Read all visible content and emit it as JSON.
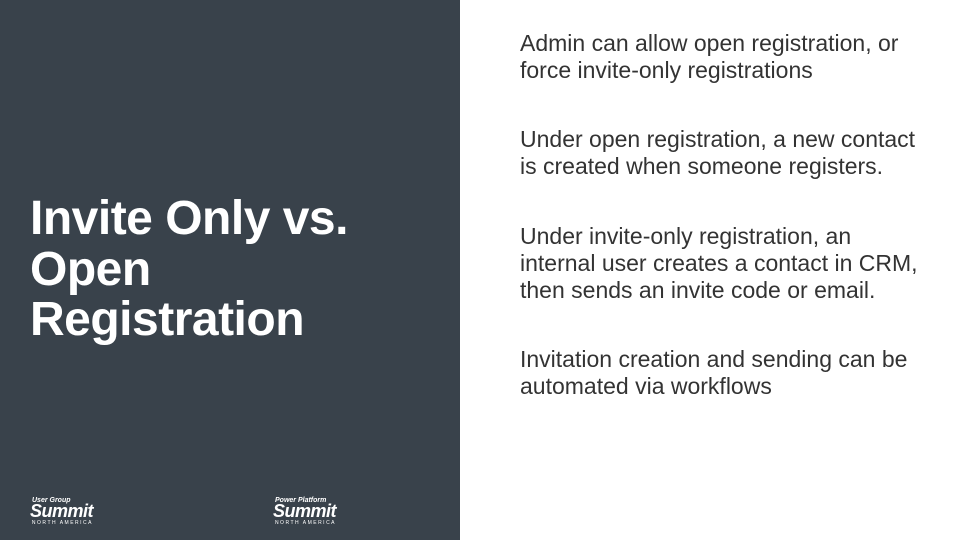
{
  "left": {
    "title": "Invite Only vs. Open Registration",
    "logos": [
      {
        "top": "User Group",
        "main": "Summit",
        "sub": "NORTH AMERICA"
      },
      {
        "top": "Power Platform",
        "main": "Summit",
        "sub": "NORTH AMERICA"
      }
    ]
  },
  "right": {
    "bullets": [
      "Admin can allow open registration, or force invite-only registrations",
      "Under open registration, a new contact is created when someone registers.",
      "Under invite-only registration, an internal user creates a contact in CRM, then sends an invite code or email.",
      "Invitation creation and sending can be automated via workflows"
    ]
  }
}
